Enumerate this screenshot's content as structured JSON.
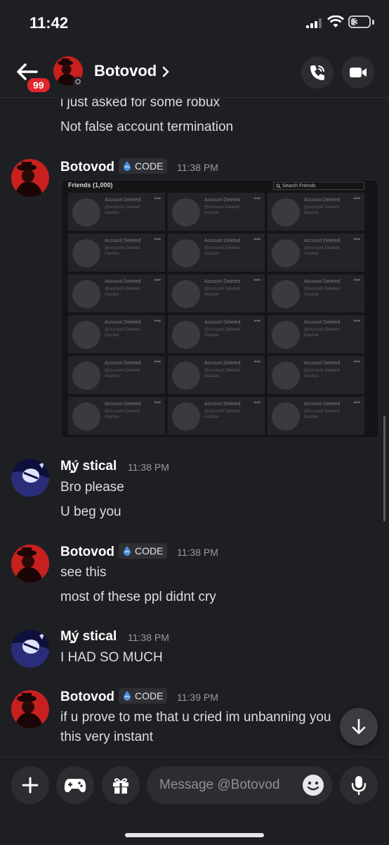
{
  "status": {
    "time": "11:42",
    "battery": "37",
    "battery_level": 0.37
  },
  "header": {
    "unread_badge": "99",
    "name": "Botovod"
  },
  "icons": [
    "back-arrow-icon",
    "phone-icon",
    "video-camera-icon",
    "tag-icon",
    "chevron-right-icon",
    "plus-icon",
    "gamepad-icon",
    "gift-icon",
    "emoji-icon",
    "microphone-icon",
    "arrow-down-icon",
    "search-icon",
    "ellipsis-icon"
  ],
  "colors": {
    "background": "#1e1f23",
    "badge_red": "#e0262b",
    "avatar_red": "#c8201e",
    "tag_blue": "#4a8fe0"
  },
  "messages": {
    "partial_1": "i just asked for some robux",
    "partial_2": "Not false account termination",
    "m1": {
      "author": "Botovod",
      "tag": "CODE",
      "time": "11:38 PM"
    },
    "m2": {
      "author": "M̧̗ý stical",
      "time": "11:38 PM",
      "lines": [
        "Bro please",
        "U beg you"
      ]
    },
    "m3": {
      "author": "Botovod",
      "tag": "CODE",
      "time": "11:38 PM",
      "lines": [
        "see this",
        "most of these ppl didnt cry"
      ]
    },
    "m4": {
      "author": "M̧̗ý stical",
      "time": "11:38 PM",
      "lines": [
        "I HAD SO MUCH"
      ]
    },
    "m5": {
      "author": "Botovod",
      "tag": "CODE",
      "time": "11:39 PM",
      "lines": [
        "if u prove to me that u cried im unbanning you",
        "this very instant"
      ]
    }
  },
  "attachment": {
    "title": "Friends (1,000)",
    "search_placeholder": "Search Friends",
    "card_name": "Account Deleted",
    "card_handle": "@Account Deleted",
    "card_status": "Inactive"
  },
  "composer": {
    "placeholder": "Message @Botovod"
  }
}
